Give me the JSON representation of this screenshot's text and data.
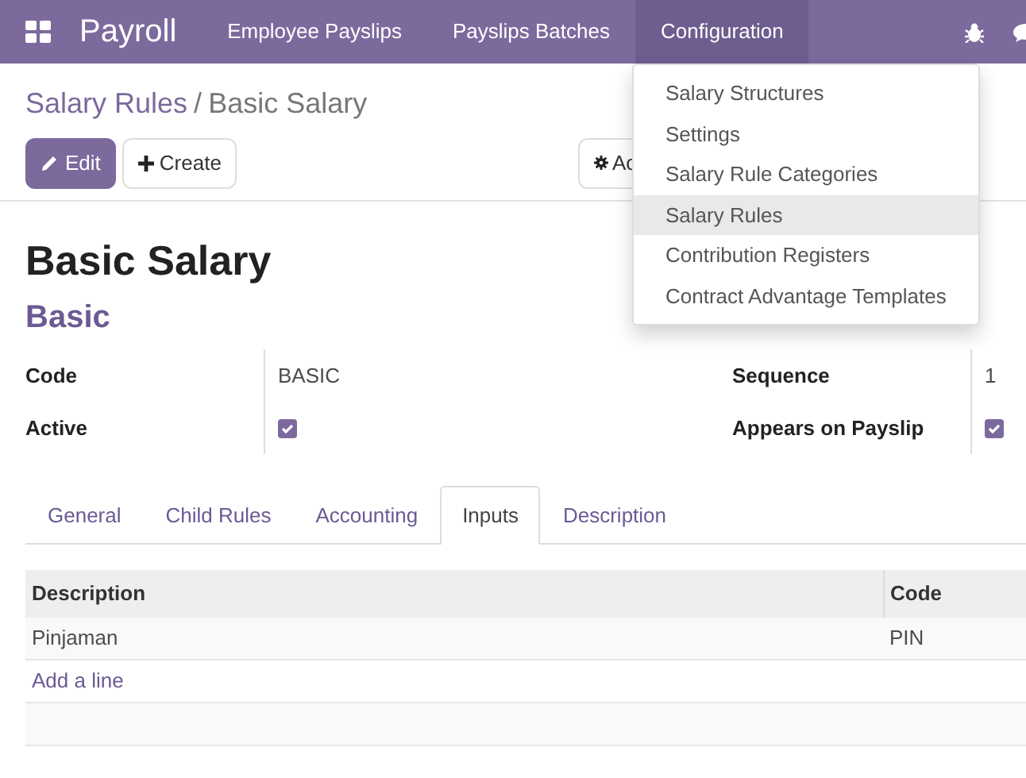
{
  "app": {
    "title": "Payroll"
  },
  "nav": [
    {
      "label": "Employee Payslips",
      "selected": false
    },
    {
      "label": "Payslips Batches",
      "selected": false
    },
    {
      "label": "Configuration",
      "selected": true
    }
  ],
  "breadcrumb_separator": "/",
  "breadcrumb": [
    {
      "label": "Salary Rules",
      "kind": "link"
    },
    {
      "label": "Basic Salary",
      "kind": "current"
    }
  ],
  "buttons": {
    "edit": "Edit",
    "create": "Create",
    "action": "Ac"
  },
  "menu": [
    {
      "label": "Salary Structures",
      "selected": false
    },
    {
      "label": "Settings",
      "selected": false
    },
    {
      "label": "Salary Rule Categories",
      "selected": false
    },
    {
      "label": "Salary Rules",
      "selected": true
    },
    {
      "label": "Contribution Registers",
      "selected": false
    },
    {
      "label": "Contract Advantage Templates",
      "selected": false
    }
  ],
  "record": {
    "title": "Basic Salary",
    "category": "Basic"
  },
  "fields": [
    {
      "label": "Code",
      "kind": "text",
      "value": "BASIC"
    },
    {
      "label": "Sequence",
      "kind": "text",
      "value": "1"
    },
    {
      "label": "Active",
      "kind": "checkbox",
      "checked": true
    },
    {
      "label": "Appears on Payslip",
      "kind": "checkbox",
      "checked": true
    }
  ],
  "tabs": [
    {
      "label": "General",
      "selected": false
    },
    {
      "label": "Child Rules",
      "selected": false
    },
    {
      "label": "Accounting",
      "selected": false
    },
    {
      "label": "Inputs",
      "selected": true
    },
    {
      "label": "Description",
      "selected": false
    }
  ],
  "table": {
    "columns": [
      "Description",
      "Code"
    ],
    "rows": [
      [
        "Pinjaman",
        "PIN"
      ]
    ],
    "add_line": "Add a line"
  }
}
